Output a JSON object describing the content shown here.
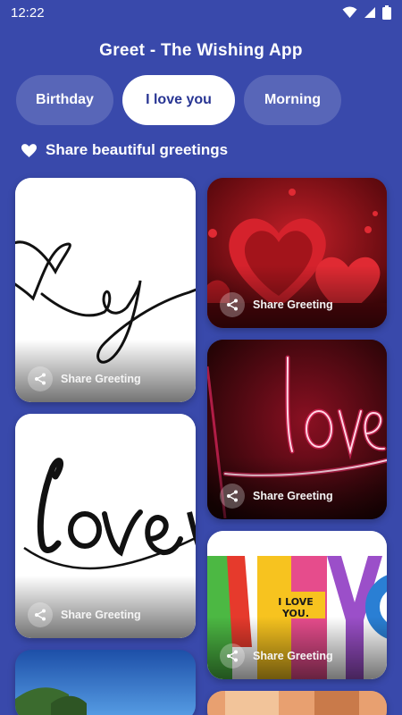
{
  "status_bar": {
    "time": "12:22"
  },
  "app": {
    "title": "Greet - The Wishing App"
  },
  "tabs": [
    {
      "label": "Birthday",
      "active": false
    },
    {
      "label": "I love you",
      "active": true
    },
    {
      "label": "Morning",
      "active": false
    }
  ],
  "tagline": "Share beautiful greetings",
  "cards": [
    {
      "image": "love-cursive-heart-script",
      "share_label": "Share Greeting"
    },
    {
      "image": "red-hearts-3d",
      "share_label": "Share Greeting"
    },
    {
      "image": "love-calligraphy",
      "share_label": "Share Greeting"
    },
    {
      "image": "neon-love-sign",
      "share_label": "Share Greeting"
    },
    {
      "image": "i-love-you-colorful-letters",
      "share_label": "Share Greeting",
      "sign_text": "I LOVE YOU."
    },
    {
      "image": "landscape-blue-sky"
    },
    {
      "image": "partial-bottom-image"
    }
  ],
  "colors": {
    "background": "#3949ab",
    "active_tab_text": "#283593",
    "active_tab_bg": "#ffffff"
  }
}
